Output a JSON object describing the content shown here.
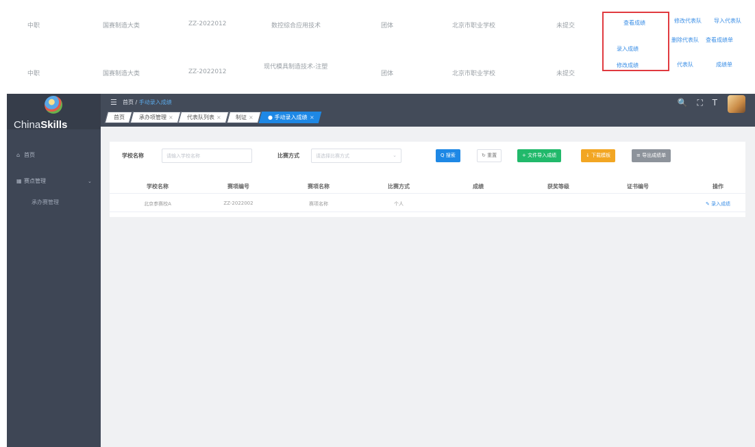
{
  "strip": {
    "row1": [
      "中职",
      "国赛制造大类",
      "ZZ-2022012",
      "数控综合应用技术",
      "团体",
      "北京市职业学校",
      "未提交"
    ],
    "row2": [
      "中职",
      "国赛制造大类",
      "ZZ-2022012",
      "现代模具制造技术-注塑",
      "团体",
      "北京市职业学校",
      "未提交"
    ],
    "dropdown": [
      "查看成绩",
      "录入成绩",
      "修改成绩"
    ],
    "actions1": [
      "修改代表队",
      "导入代表队",
      "删除代表队",
      "查看成绩单"
    ],
    "actions2": [
      "代表队",
      "成绩单"
    ]
  },
  "sidebar": {
    "brand_prefix": "China",
    "brand_suffix": "Skills",
    "items": [
      {
        "icon": "home-icon",
        "label": "首页"
      },
      {
        "icon": "grid-icon",
        "label": "赛点管理"
      }
    ],
    "sub_items": [
      "承办赛管理"
    ]
  },
  "topbar": {
    "menu_icon": "☰",
    "breadcrumb_root": "首页 /",
    "breadcrumb_current": "手动录入成绩",
    "icons": "🔍 ⛶ T"
  },
  "tabs": [
    {
      "label": "首页",
      "active": false
    },
    {
      "label": "承办项管理",
      "active": false
    },
    {
      "label": "代表队列表",
      "active": false
    },
    {
      "label": "制证",
      "active": false
    },
    {
      "label": "● 手动录入成绩",
      "active": true
    }
  ],
  "filter": {
    "school_label": "学校名称",
    "school_placeholder": "请输入学校名称",
    "mode_label": "比赛方式",
    "mode_placeholder": "请选择比赛方式",
    "search_btn": "Q 搜索",
    "reset_btn": "↻ 重置",
    "import_btn": "+ 文件导入成绩",
    "download_btn": "↓ 下载模板",
    "print_btn": "≡ 导出成绩单"
  },
  "table": {
    "headers": [
      "学校名称",
      "赛项编号",
      "赛项名称",
      "比赛方式",
      "成绩",
      "获奖等级",
      "证书编号",
      "操作"
    ],
    "rows": [
      [
        "北京参赛校A",
        "ZZ-2022002",
        "赛项名称",
        "个人",
        "",
        "",
        "",
        "✎ 录入成绩"
      ]
    ]
  },
  "colors": {
    "primary": "#1e88e5",
    "success": "#21b96b",
    "warning": "#f2a623",
    "info": "#8d939b",
    "highlight_box": "#e0393e",
    "sidebar_bg": "#3e4655"
  }
}
